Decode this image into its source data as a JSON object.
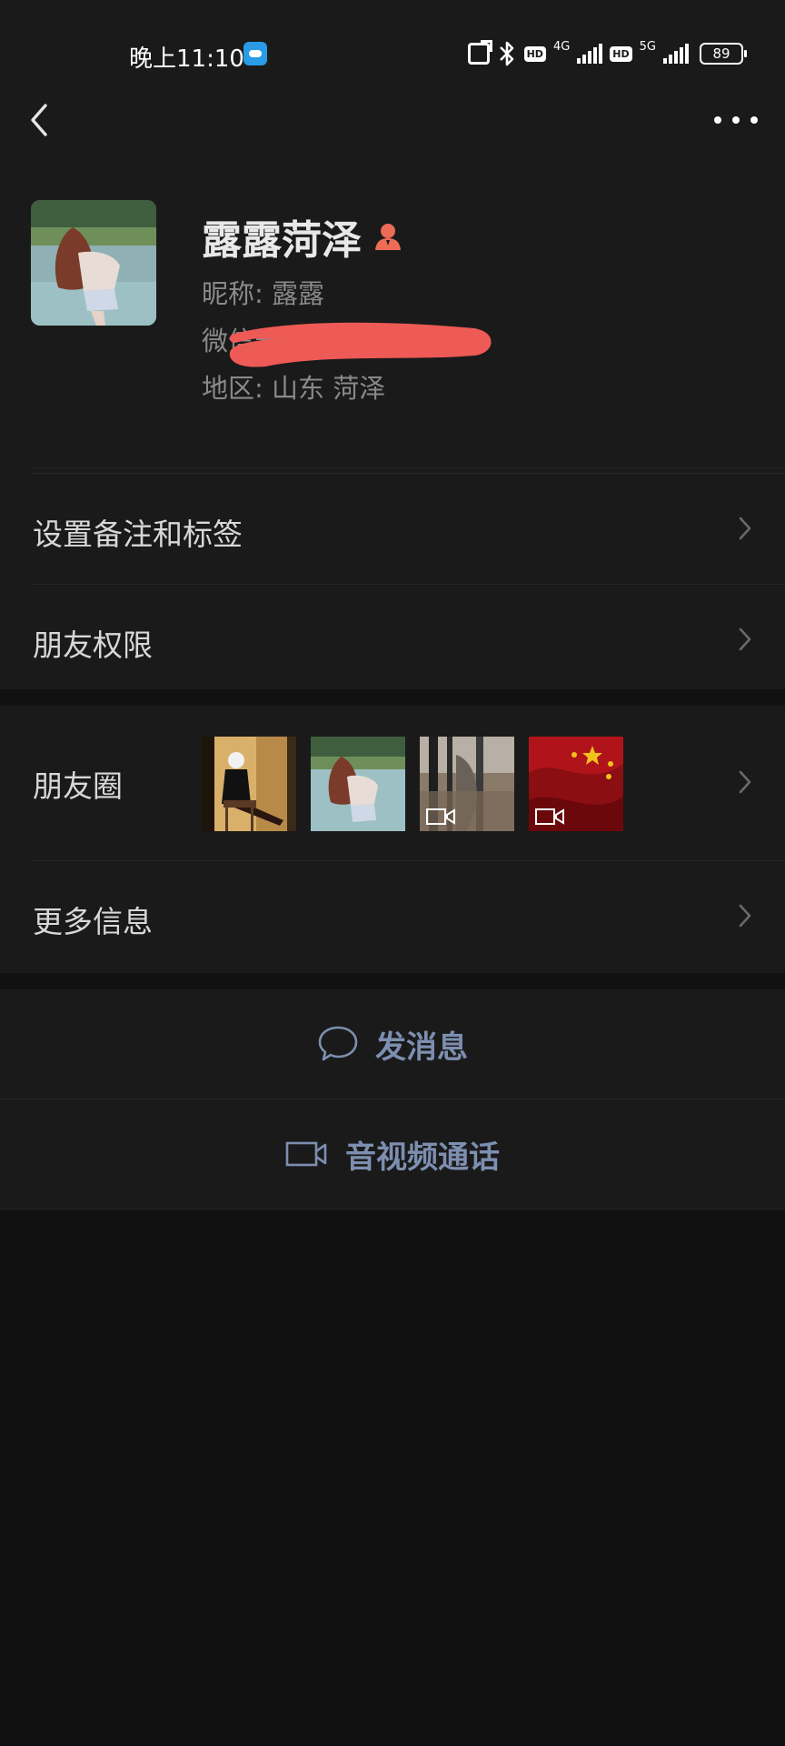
{
  "status_bar": {
    "time": "晚上11:10",
    "network_1": "4G",
    "network_2": "5G",
    "hd_label": "HD",
    "battery": "89"
  },
  "header": {
    "back_icon": "chevron-left-icon",
    "more_icon": "more-horizontal-icon"
  },
  "profile": {
    "name": "露露菏泽",
    "nickname_line": "昵称:  露露",
    "wechat_id_line": "微信号:",
    "region_line": "地区:  山东  菏泽",
    "badge_color": "#ee6b56"
  },
  "menu": {
    "remark_tags": "设置备注和标签",
    "friend_permissions": "朋友权限",
    "moments": "朋友圈",
    "more_info": "更多信息"
  },
  "moments_thumbs": [
    {
      "name": "thumb-photo-1",
      "type": "photo"
    },
    {
      "name": "thumb-photo-2",
      "type": "photo"
    },
    {
      "name": "thumb-video-1",
      "type": "video"
    },
    {
      "name": "thumb-video-2",
      "type": "video"
    }
  ],
  "actions": {
    "send_message": "发消息",
    "av_call": "音视频通话",
    "accent_color": "#7d8fb0"
  }
}
